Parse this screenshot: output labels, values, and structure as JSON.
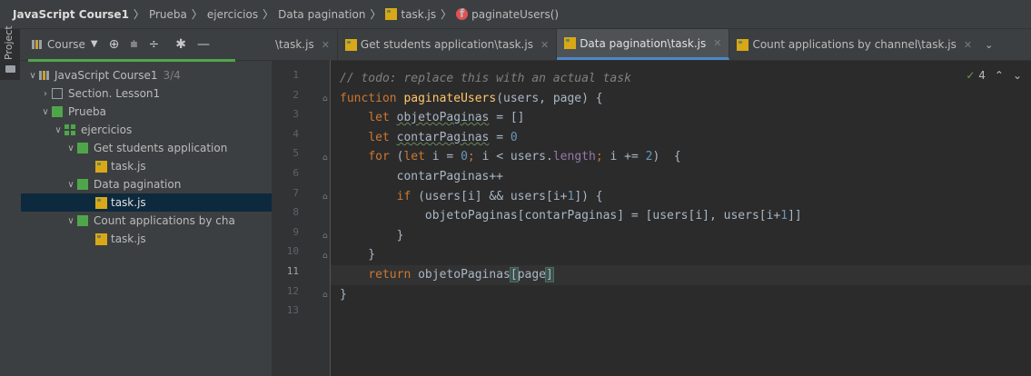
{
  "breadcrumb": {
    "items": [
      "JavaScript Course1",
      "Prueba",
      "ejercicios",
      "Data pagination",
      "task.js",
      "paginateUsers()"
    ]
  },
  "sidebar_strip": {
    "label": "Project"
  },
  "project_panel": {
    "course_label": "Course",
    "tree": [
      {
        "label": "JavaScript Course1",
        "extra": "3/4"
      },
      {
        "label": "Section. Lesson1"
      },
      {
        "label": "Prueba"
      },
      {
        "label": "ejercicios"
      },
      {
        "label": "Get students application"
      },
      {
        "label": "task.js"
      },
      {
        "label": "Data pagination"
      },
      {
        "label": "task.js"
      },
      {
        "label": "Count applications by cha"
      },
      {
        "label": "task.js"
      }
    ]
  },
  "editor_tabs": [
    {
      "label": "\\task.js"
    },
    {
      "label": "Get students application\\task.js"
    },
    {
      "label": "Data pagination\\task.js"
    },
    {
      "label": "Count applications by channel\\task.js"
    }
  ],
  "inspection": {
    "count": "4"
  },
  "line_numbers": [
    "1",
    "2",
    "3",
    "4",
    "5",
    "6",
    "7",
    "8",
    "9",
    "10",
    "11",
    "12",
    "13"
  ]
}
